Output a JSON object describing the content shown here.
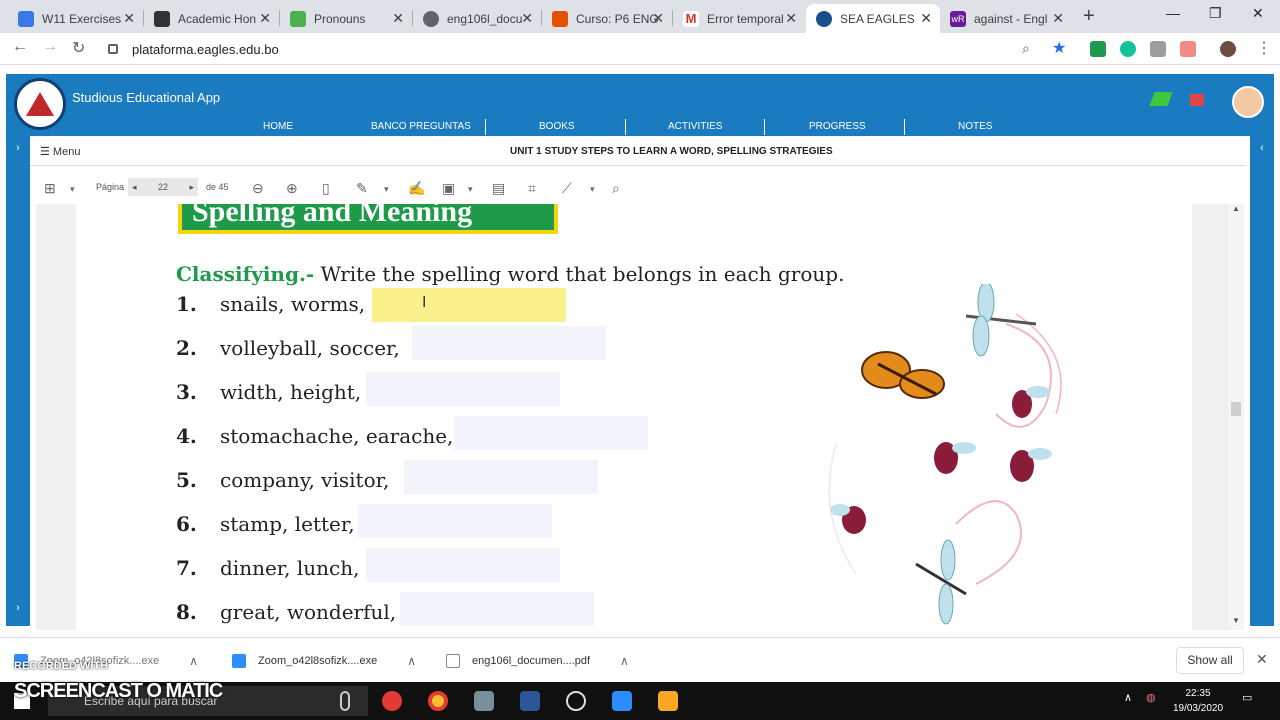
{
  "browser": {
    "tabs": [
      {
        "title": "W11 Exercises",
        "color": "#3b78e7"
      },
      {
        "title": "Academic Hon",
        "color": "#333333"
      },
      {
        "title": "Pronouns",
        "color": "#4caf50"
      },
      {
        "title": "eng106l_docu",
        "color": "#5f6368"
      },
      {
        "title": "Curso: P6 ENG",
        "color": "#e65100"
      },
      {
        "title": "Error temporal",
        "color": "#d93025"
      },
      {
        "title": "SEA EAGLES",
        "color": "#1a4f8c"
      },
      {
        "title": "against - Engl",
        "color": "#6a1b9a"
      }
    ],
    "url": "plataforma.eagles.edu.bo"
  },
  "app": {
    "title": "Studious Educational App",
    "nav": [
      "HOME",
      "BANCO PREGUNTAS",
      "BOOKS",
      "ACTIVITIES",
      "PROGRESS",
      "NOTES"
    ],
    "menu_label": "Menu",
    "unit_title": "UNIT 1 STUDY STEPS TO LEARN A WORD, SPELLING STRATEGIES"
  },
  "pdf": {
    "page_label": "Página",
    "page": "22",
    "page_of": "de 45"
  },
  "document": {
    "banner": "Spelling and Meaning",
    "instruction_lead": "Classifying.-",
    "instruction_text": " Write the spelling word that belongs in each group.",
    "items": [
      {
        "num": "1.",
        "text": "snails, worms,"
      },
      {
        "num": "2.",
        "text": "volleyball, soccer,"
      },
      {
        "num": "3.",
        "text": "width, height,"
      },
      {
        "num": "4.",
        "text": "stomachache, earache,"
      },
      {
        "num": "5.",
        "text": "company, visitor,"
      },
      {
        "num": "6.",
        "text": "stamp, letter,"
      },
      {
        "num": "7.",
        "text": "dinner, lunch,"
      },
      {
        "num": "8.",
        "text": "great, wonderful,"
      }
    ]
  },
  "downloads": [
    {
      "name": "Zoom_o42l8sofizk....exe"
    },
    {
      "name": "Zoom_o42l8sofizk....exe"
    },
    {
      "name": "eng106l_documen....pdf"
    }
  ],
  "downloads_show_all": "Show all",
  "taskbar": {
    "search_placeholder": "Escribe aquí para buscar",
    "time": "22:35",
    "date": "19/03/2020"
  },
  "watermark": {
    "line1": "RECORDED WITH",
    "line2": "SCREENCAST O MATIC"
  }
}
